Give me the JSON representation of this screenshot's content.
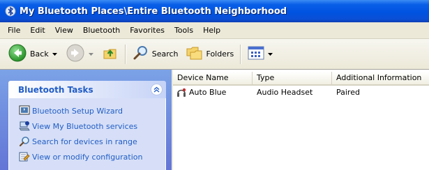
{
  "window": {
    "title": "My Bluetooth Places\\Entire Bluetooth Neighborhood",
    "icon": "bluetooth-places-icon"
  },
  "menubar": {
    "items": [
      "File",
      "Edit",
      "View",
      "Bluetooth",
      "Favorites",
      "Tools",
      "Help"
    ]
  },
  "toolbar": {
    "back_label": "Back",
    "search_label": "Search",
    "folders_label": "Folders"
  },
  "task_pane": {
    "title": "Bluetooth Tasks",
    "links": [
      {
        "label": "Bluetooth Setup Wizard",
        "icon": "setup-wizard-icon"
      },
      {
        "label": "View My Bluetooth services",
        "icon": "bluetooth-services-icon"
      },
      {
        "label": "Search for devices in range",
        "icon": "search-icon"
      },
      {
        "label": "View or modify configuration",
        "icon": "configuration-icon"
      }
    ]
  },
  "list": {
    "columns": [
      "Device Name",
      "Type",
      "Additional Information"
    ],
    "rows": [
      {
        "name": "Auto Blue",
        "type": "Audio Headset",
        "info": "Paired",
        "icon": "headset-device-icon"
      }
    ]
  },
  "colors": {
    "titlebar": "#0053e0",
    "taskpane": "#6375d6",
    "task_link": "#215dc6",
    "menubar": "#ece9d8"
  }
}
